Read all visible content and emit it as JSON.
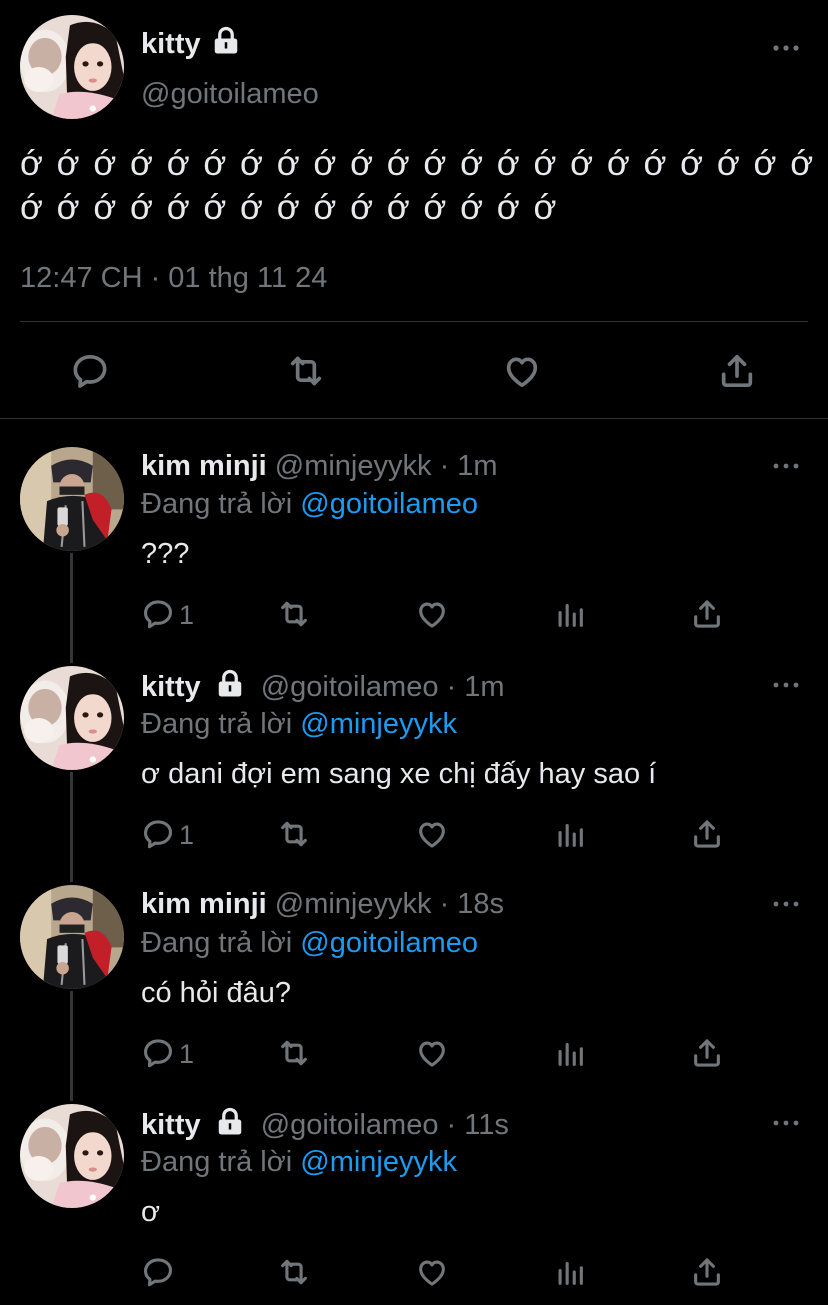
{
  "main_tweet": {
    "name": "kitty",
    "handle": "@goitoilameo",
    "text": "ớ ớ ớ ớ ớ ớ ớ ớ ớ ớ ớ ớ ớ ớ ớ ớ ớ ớ ớ ớ ớ ớ ớ ớ ớ ớ ớ ớ ớ ớ ớ ớ ớ ớ ớ ớ ớ",
    "timestamp": "12:47 CH · 01 thg 11 24"
  },
  "replies": [
    {
      "name": "kim minji",
      "handle": "@minjeyykk",
      "time": "· 1m",
      "reply_label": "Đang trả lời",
      "reply_to": "@goitoilameo",
      "text": "???",
      "reply_count": "1"
    },
    {
      "name": "kitty",
      "handle": "@goitoilameo",
      "time": "· 1m",
      "reply_label": "Đang trả lời",
      "reply_to": "@minjeyykk",
      "text": "ơ dani đợi em sang xe chị đấy hay sao í",
      "reply_count": "1"
    },
    {
      "name": "kim minji",
      "handle": "@minjeyykk",
      "time": "· 18s",
      "reply_label": "Đang trả lời",
      "reply_to": "@goitoilameo",
      "text": "có hỏi đâu?",
      "reply_count": "1"
    },
    {
      "name": "kitty",
      "handle": "@goitoilameo",
      "time": "· 11s",
      "reply_label": "Đang trả lời",
      "reply_to": "@minjeyykk",
      "text": "ơ",
      "reply_count": ""
    }
  ],
  "colors": {
    "background": "#000000",
    "text_primary": "#e7e9ea",
    "text_secondary": "#71767b",
    "mention": "#1d9bf0"
  },
  "icons": [
    "lock-icon",
    "more-icon",
    "reply-icon",
    "retweet-icon",
    "like-icon",
    "views-icon",
    "share-icon"
  ]
}
